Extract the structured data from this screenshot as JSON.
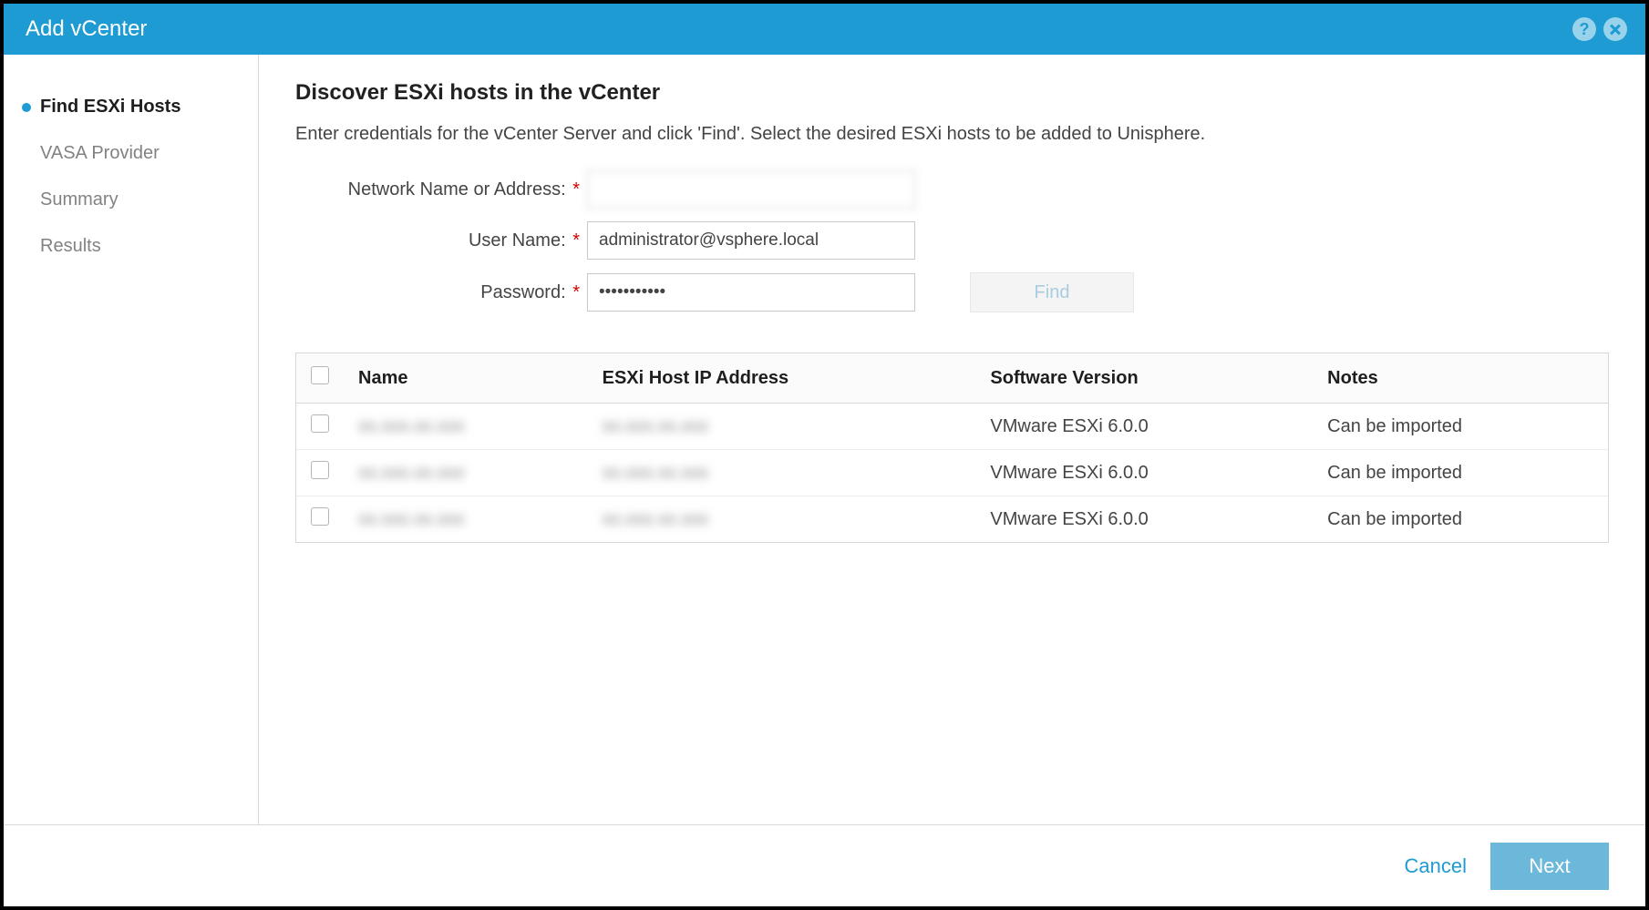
{
  "titlebar": {
    "title": "Add vCenter"
  },
  "sidebar": {
    "steps": [
      {
        "label": "Find ESXi Hosts",
        "active": true
      },
      {
        "label": "VASA Provider",
        "active": false
      },
      {
        "label": "Summary",
        "active": false
      },
      {
        "label": "Results",
        "active": false
      }
    ]
  },
  "main": {
    "heading": "Discover ESXi hosts in the vCenter",
    "instruction": "Enter credentials for the vCenter Server and click 'Find'. Select the desired ESXi hosts to be added to Unisphere.",
    "form": {
      "network_label": "Network Name or Address:",
      "network_value": "",
      "username_label": "User Name:",
      "username_value": "administrator@vsphere.local",
      "password_label": "Password:",
      "password_value": "•••••••••••",
      "find_label": "Find"
    },
    "table": {
      "headers": {
        "name": "Name",
        "ip": "ESXi Host IP Address",
        "version": "Software Version",
        "notes": "Notes"
      },
      "rows": [
        {
          "name": "",
          "ip": "",
          "version": "VMware ESXi 6.0.0",
          "notes": "Can be imported"
        },
        {
          "name": "",
          "ip": "",
          "version": "VMware ESXi 6.0.0",
          "notes": "Can be imported"
        },
        {
          "name": "",
          "ip": "",
          "version": "VMware ESXi 6.0.0",
          "notes": "Can be imported"
        }
      ]
    }
  },
  "footer": {
    "cancel": "Cancel",
    "next": "Next"
  }
}
